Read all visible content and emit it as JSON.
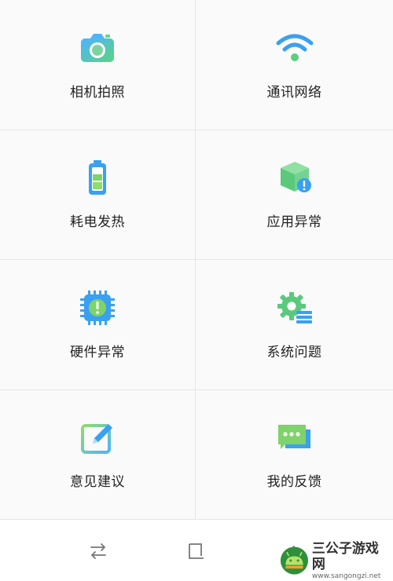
{
  "menu": {
    "items": [
      {
        "label": "相机拍照",
        "icon": "camera-icon"
      },
      {
        "label": "通讯网络",
        "icon": "wifi-icon"
      },
      {
        "label": "耗电发热",
        "icon": "battery-icon"
      },
      {
        "label": "应用异常",
        "icon": "app-box-alert-icon"
      },
      {
        "label": "硬件异常",
        "icon": "chip-alert-icon"
      },
      {
        "label": "系统问题",
        "icon": "gear-list-icon"
      },
      {
        "label": "意见建议",
        "icon": "edit-note-icon"
      },
      {
        "label": "我的反馈",
        "icon": "chat-bubble-icon"
      }
    ]
  },
  "navbar": {
    "icons": [
      "switch-arrows-icon",
      "home-square-icon",
      "back-icon"
    ]
  },
  "watermark": {
    "title": "三公子游戏网",
    "url": "www.sangongzi.net"
  },
  "colors": {
    "blue": "#3aa0f0",
    "green": "#5fd07a",
    "divider": "#e6e6e6"
  }
}
